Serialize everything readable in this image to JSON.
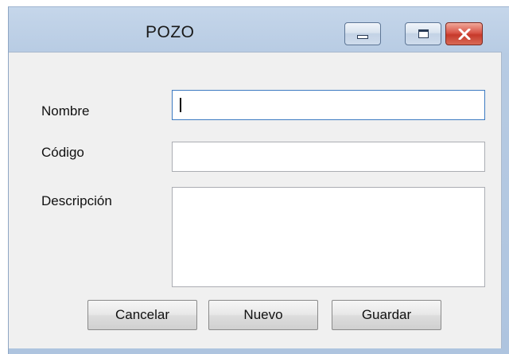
{
  "window": {
    "title": "POZO",
    "controls": {
      "minimize": "minimize",
      "maximize": "maximize",
      "close": "close"
    }
  },
  "form": {
    "fields": {
      "nombre": {
        "label": "Nombre",
        "value": ""
      },
      "codigo": {
        "label": "Código",
        "value": ""
      },
      "descripcion": {
        "label": "Descripción",
        "value": ""
      }
    },
    "buttons": {
      "cancelar": "Cancelar",
      "nuevo": "Nuevo",
      "guardar": "Guardar"
    }
  },
  "colors": {
    "accent_focus": "#3d7bc2",
    "close_button": "#c63a2b",
    "client_background": "#f0f0f0"
  }
}
